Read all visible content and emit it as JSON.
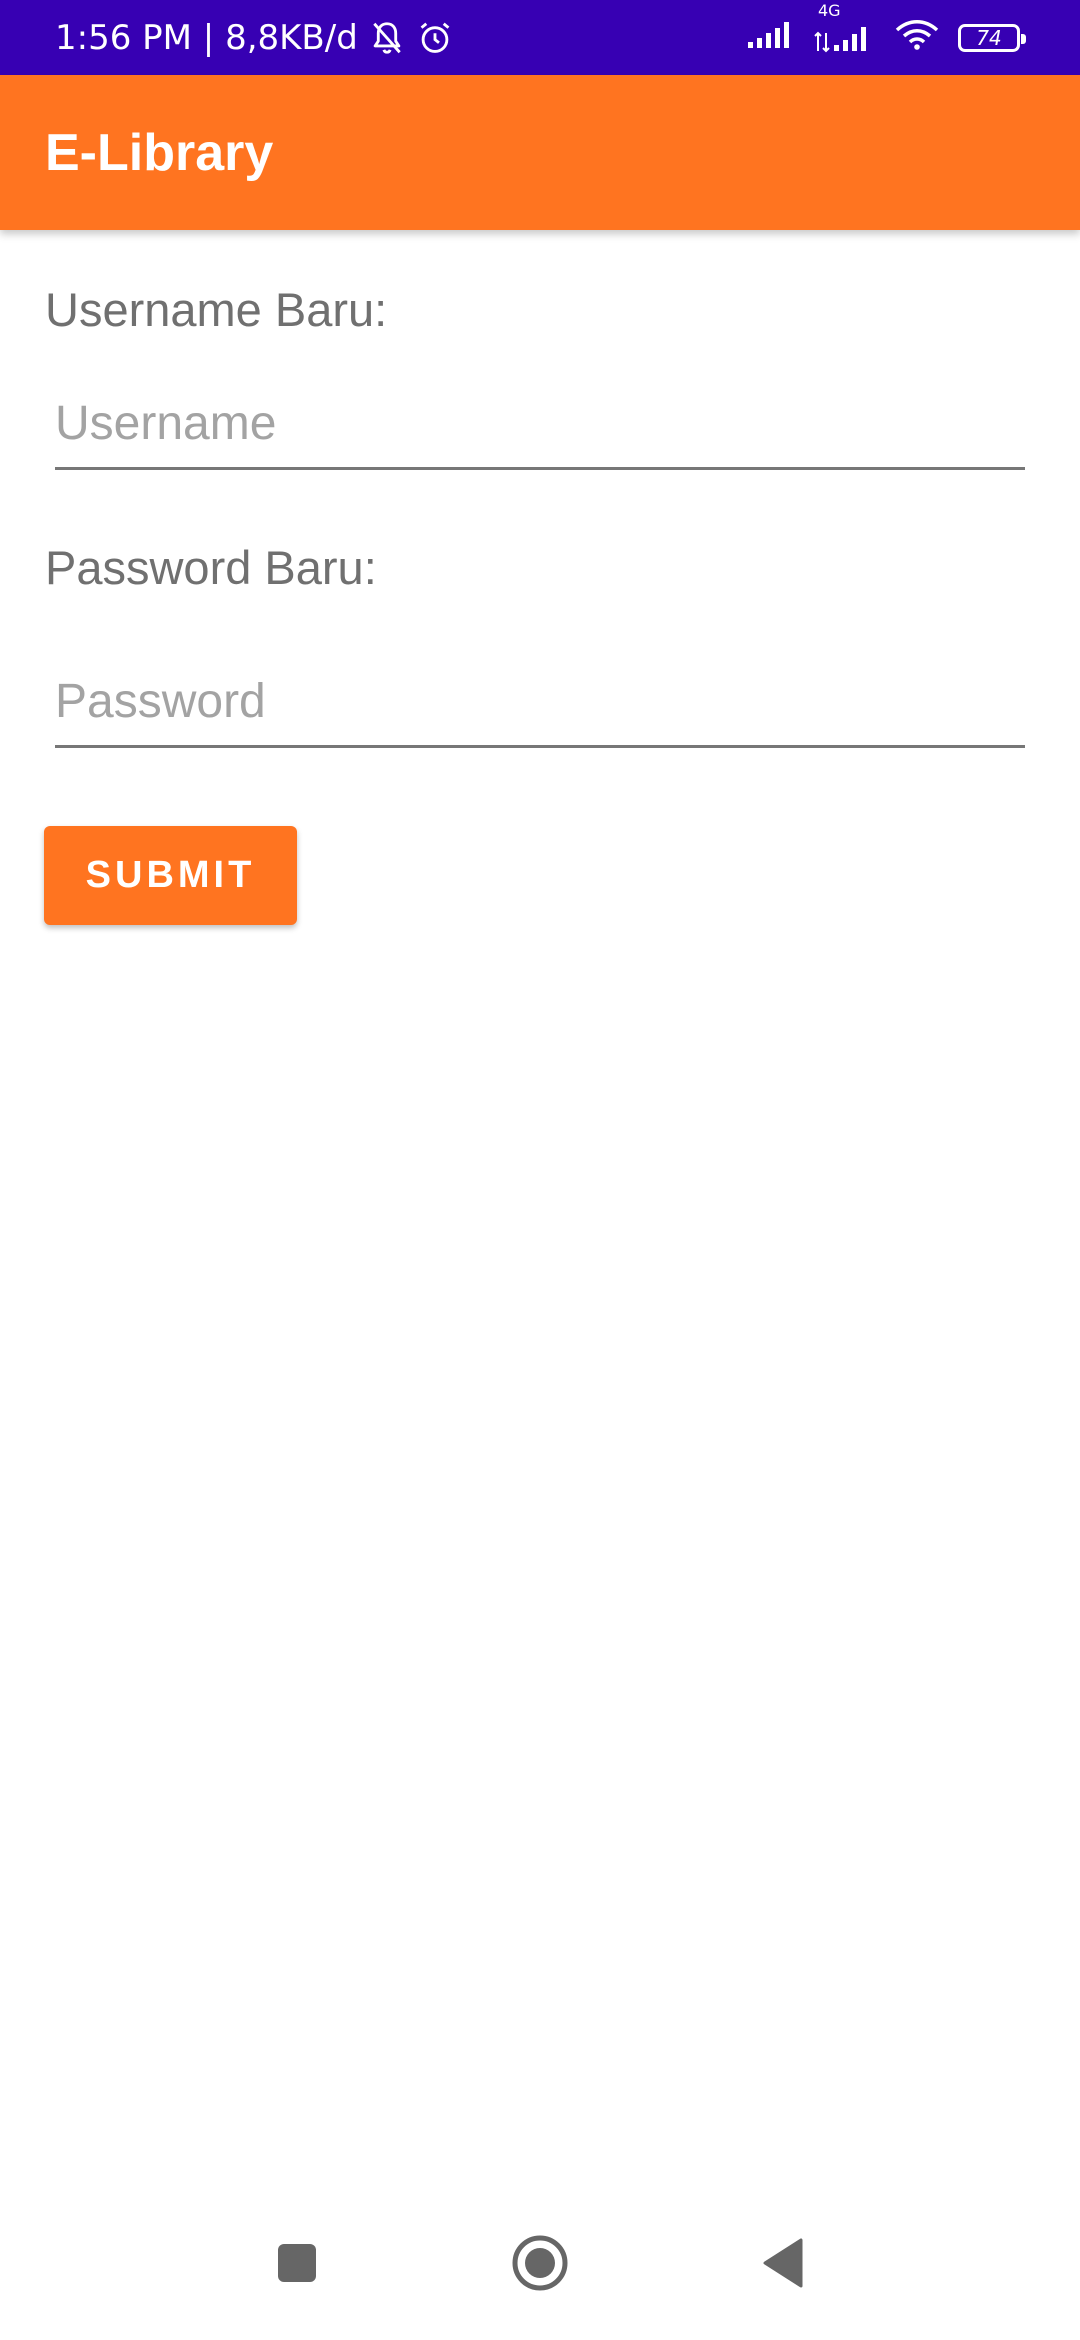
{
  "status_bar": {
    "time_info": "1:56 PM | 8,8KB/d",
    "network_label": "4G",
    "battery_level": "74",
    "icons": [
      "bell-off-icon",
      "alarm-icon",
      "signal-icon",
      "signal-4g-icon",
      "wifi-icon",
      "battery-icon"
    ]
  },
  "app_bar": {
    "title": "E-Library"
  },
  "form": {
    "username_label": "Username Baru:",
    "username_placeholder": "Username",
    "username_value": "",
    "password_label": "Password Baru:",
    "password_placeholder": "Password",
    "password_value": "",
    "submit_label": "SUBMIT"
  },
  "nav_bar": {
    "icons": [
      "recents-square-icon",
      "home-circle-icon",
      "back-triangle-icon"
    ]
  },
  "colors": {
    "status_bar": "#3700B3",
    "accent": "#FF7420",
    "label_text": "#707070",
    "placeholder_text": "#A3A3A3"
  }
}
